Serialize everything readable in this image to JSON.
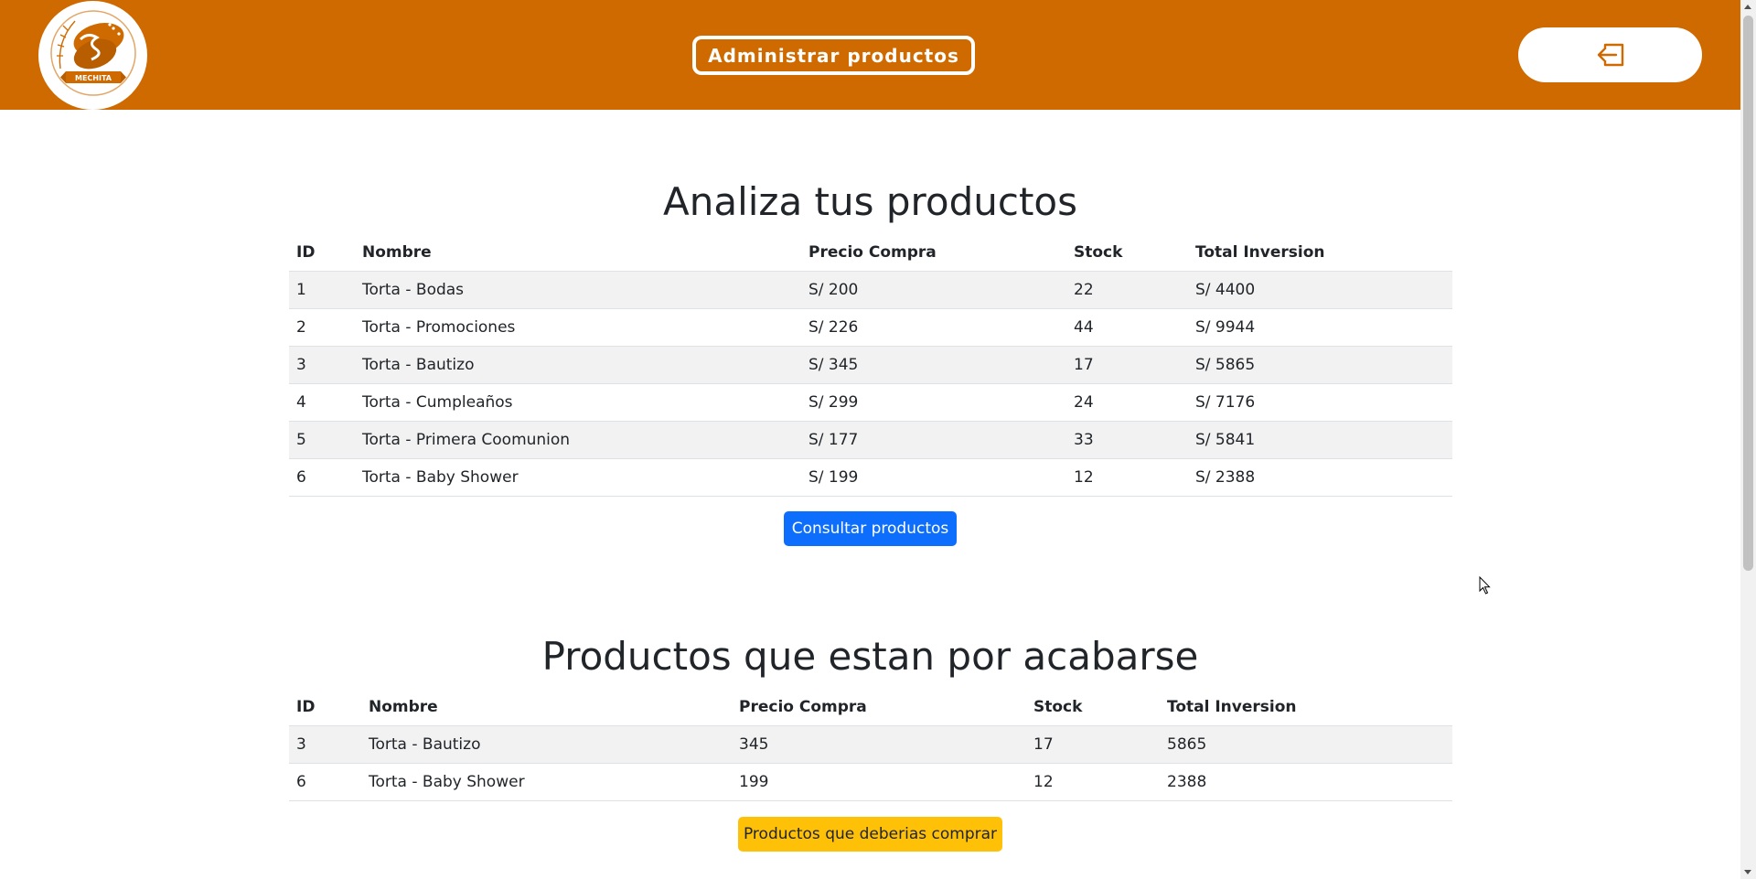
{
  "header": {
    "logo_text": "MECHITA",
    "title": "Administrar productos",
    "logout_icon": "logout-icon",
    "colors": {
      "bar": "#cf6a00",
      "text": "#ffffff"
    }
  },
  "products": {
    "title": "Analiza tus productos",
    "columns": [
      "ID",
      "Nombre",
      "Precio Compra",
      "Stock",
      "Total Inversion"
    ],
    "rows": [
      {
        "id": "1",
        "nombre": "Torta - Bodas",
        "precio": "S/ 200",
        "stock": "22",
        "total": "S/ 4400"
      },
      {
        "id": "2",
        "nombre": "Torta - Promociones",
        "precio": "S/ 226",
        "stock": "44",
        "total": "S/ 9944"
      },
      {
        "id": "3",
        "nombre": "Torta - Bautizo",
        "precio": "S/ 345",
        "stock": "17",
        "total": "S/ 5865"
      },
      {
        "id": "4",
        "nombre": "Torta - Cumpleaños",
        "precio": "S/ 299",
        "stock": "24",
        "total": "S/ 7176"
      },
      {
        "id": "5",
        "nombre": "Torta - Primera Coomunion",
        "precio": "S/ 177",
        "stock": "33",
        "total": "S/ 5841"
      },
      {
        "id": "6",
        "nombre": "Torta - Baby Shower",
        "precio": "S/ 199",
        "stock": "12",
        "total": "S/ 2388"
      }
    ],
    "button": "Consultar productos"
  },
  "low_stock": {
    "title": "Productos que estan por acabarse",
    "columns": [
      "ID",
      "Nombre",
      "Precio Compra",
      "Stock",
      "Total Inversion"
    ],
    "rows": [
      {
        "id": "3",
        "nombre": "Torta - Bautizo",
        "precio": "345",
        "stock": "17",
        "total": "5865"
      },
      {
        "id": "6",
        "nombre": "Torta - Baby Shower",
        "precio": "199",
        "stock": "12",
        "total": "2388"
      }
    ],
    "button": "Productos que deberias comprar"
  }
}
